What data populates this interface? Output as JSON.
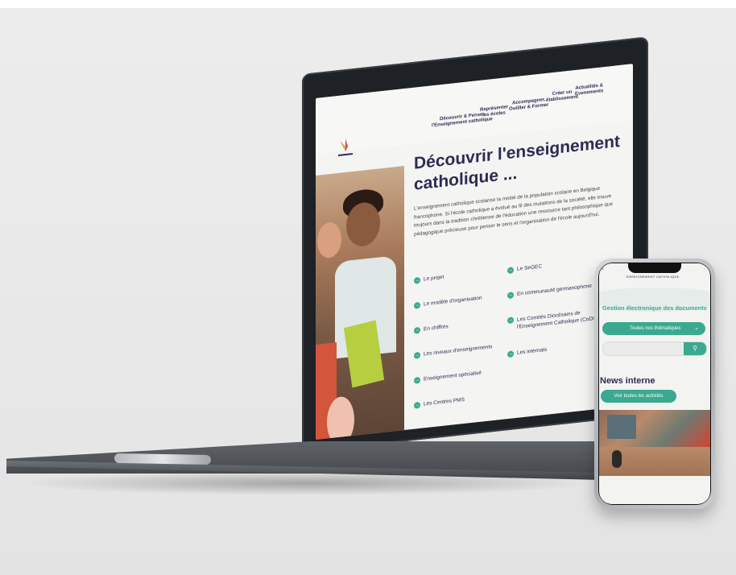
{
  "laptop": {
    "nav": [
      {
        "line1": "Découvrir & Penser",
        "line2": "l'Enseignement catholique"
      },
      {
        "line1": "Représenter",
        "line2": "les écoles"
      },
      {
        "line1": "Accompagner,",
        "line2": "Outiller & Former"
      },
      {
        "line1": "Créer un",
        "line2": "établissement"
      },
      {
        "line1": "Actualités &",
        "line2": "Evenements"
      }
    ],
    "heading_line1": "Découvrir l'enseignement",
    "heading_line2": "catholique ...",
    "intro": "L'enseignement catholique scolarise la moitié de la population scolaire en Belgique francophone. Si l'école catholique a évolué au fil des mutations de la société, elle trouve toujours dans la tradition chrétienne de l'éducation une ressource tant philosophique que pédagogique précieuse pour penser le sens et l'organisation de l'école aujourd'hui.",
    "links_left": [
      "Le projet",
      "Le modèle d'organisation",
      "En chiffres",
      "Les niveaux d'enseignements",
      "Enseignement spécialisé",
      "Les Centres PMS"
    ],
    "links_right": [
      "Le SeGEC",
      "En communauté germanophone",
      "Les Comités Diocésains de l'Enseignement Catholique (CoDIEC)",
      "Les internats"
    ],
    "link_arrow": "→"
  },
  "phone": {
    "brand": "ENSEIGNEMENT CATHOLIQUE",
    "section_title": "Gestion électronique des documents",
    "select_value": "Toutes nos thématiques",
    "select_chevron": "⌄",
    "search_icon": "search-icon",
    "search_glyph": "⚲",
    "news_title": "News interne",
    "news_button": "Voir toutes les activités",
    "menu_glyph": "≡"
  },
  "colors": {
    "accent_green": "#3aa98f",
    "navy": "#2c2c54",
    "background": "#e8e8e8"
  }
}
